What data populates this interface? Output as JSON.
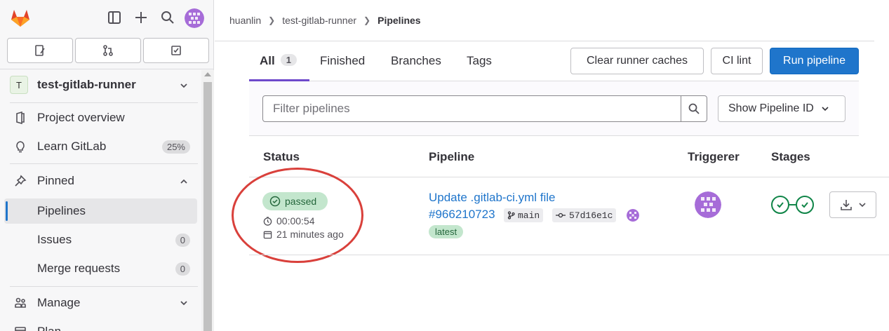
{
  "sidebar": {
    "project_letter": "T",
    "project_name": "test-gitlab-runner",
    "items": [
      {
        "label": "Project overview"
      },
      {
        "label": "Learn GitLab",
        "badge": "25%"
      },
      {
        "label": "Pinned"
      },
      {
        "label": "Pipelines"
      },
      {
        "label": "Issues",
        "badge": "0"
      },
      {
        "label": "Merge requests",
        "badge": "0"
      },
      {
        "label": "Manage"
      },
      {
        "label": "Plan"
      }
    ]
  },
  "breadcrumb": [
    "huanlin",
    "test-gitlab-runner",
    "Pipelines"
  ],
  "tabs": [
    {
      "label": "All",
      "count": "1"
    },
    {
      "label": "Finished"
    },
    {
      "label": "Branches"
    },
    {
      "label": "Tags"
    }
  ],
  "actions": {
    "clear_caches": "Clear runner caches",
    "ci_lint": "CI lint",
    "run_pipeline": "Run pipeline"
  },
  "filter": {
    "placeholder": "Filter pipelines",
    "show_id": "Show Pipeline ID"
  },
  "table": {
    "headers": [
      "Status",
      "Pipeline",
      "Triggerer",
      "Stages"
    ],
    "rows": [
      {
        "status": "passed",
        "duration": "00:00:54",
        "finished": "21 minutes ago",
        "title": "Update .gitlab-ci.yml file",
        "id": "#966210723",
        "branch": "main",
        "commit": "57d16e1c",
        "tag": "latest"
      }
    ]
  },
  "colors": {
    "primary": "#1f75cb",
    "success": "#108548",
    "tab_active": "#6e49cb",
    "annotation": "#d9403b"
  }
}
